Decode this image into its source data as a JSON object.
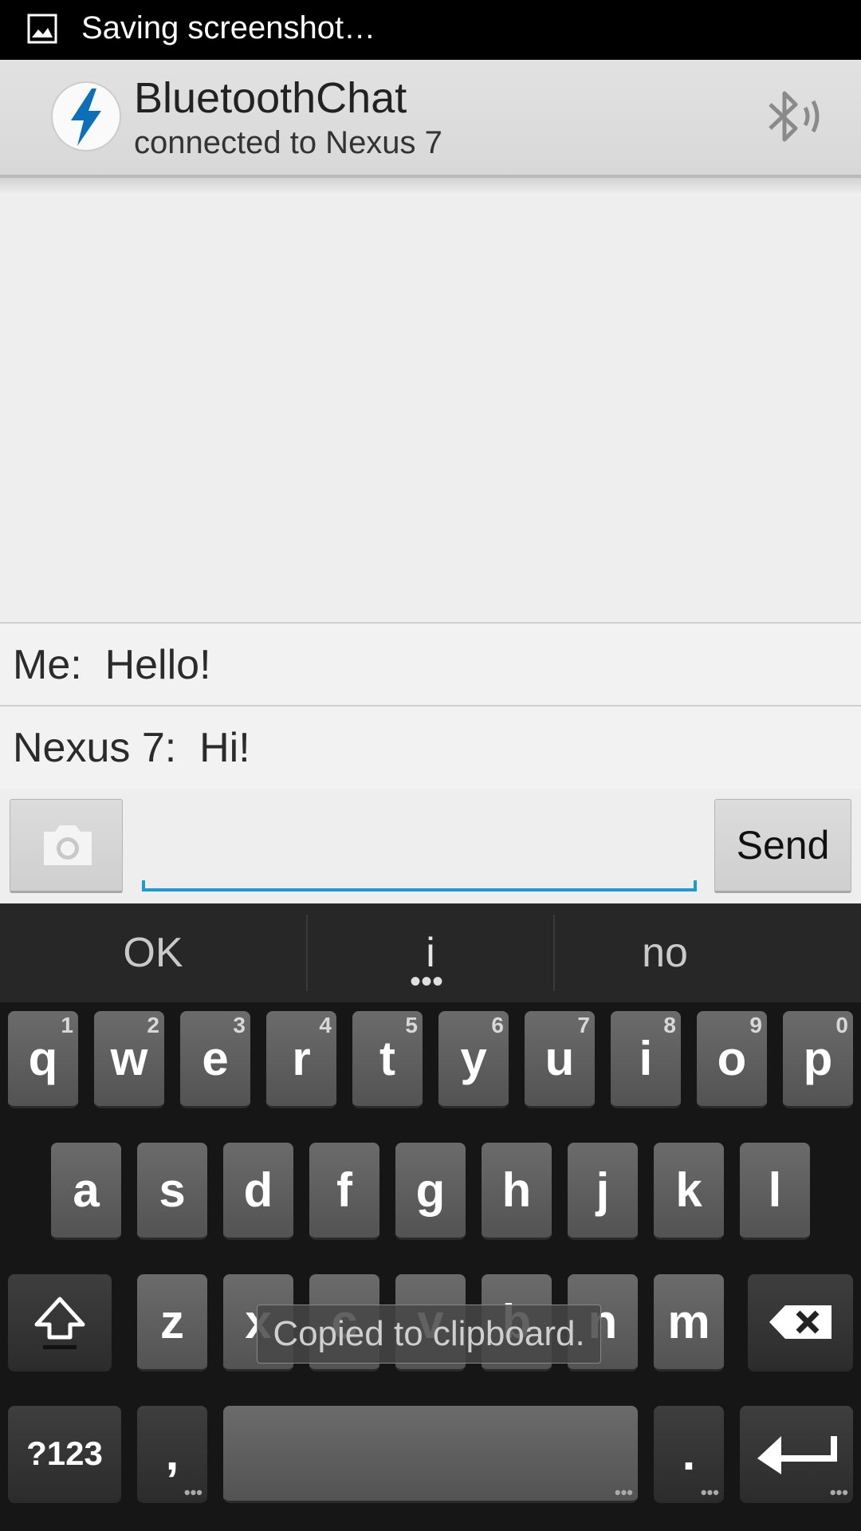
{
  "status_bar": {
    "text": "Saving screenshot…",
    "icon": "image-icon"
  },
  "action_bar": {
    "title": "BluetoothChat",
    "subtitle": "connected to Nexus 7",
    "app_icon": "lightning-bolt-icon",
    "action_icon": "bluetooth-discoverable-icon",
    "accent_color": "#0d6fb8"
  },
  "messages": [
    {
      "text": "Me:  Hello!"
    },
    {
      "text": "Nexus 7:  Hi!"
    }
  ],
  "compose": {
    "camera_icon": "camera-icon",
    "input_value": "",
    "send_label": "Send",
    "accent_color": "#1e9ad2"
  },
  "keyboard": {
    "suggestions": [
      "OK",
      "i",
      "no"
    ],
    "row1": [
      {
        "k": "q",
        "h": "1"
      },
      {
        "k": "w",
        "h": "2"
      },
      {
        "k": "e",
        "h": "3"
      },
      {
        "k": "r",
        "h": "4"
      },
      {
        "k": "t",
        "h": "5"
      },
      {
        "k": "y",
        "h": "6"
      },
      {
        "k": "u",
        "h": "7"
      },
      {
        "k": "i",
        "h": "8"
      },
      {
        "k": "o",
        "h": "9"
      },
      {
        "k": "p",
        "h": "0"
      }
    ],
    "row2": [
      "a",
      "s",
      "d",
      "f",
      "g",
      "h",
      "j",
      "k",
      "l"
    ],
    "row3": [
      "z",
      "x",
      "c",
      "v",
      "b",
      "n",
      "m"
    ],
    "symbols_label": "?123",
    "comma_label": ",",
    "period_label": ".",
    "shift_icon": "shift-icon",
    "backspace_icon": "backspace-icon",
    "enter_icon": "enter-icon"
  },
  "toast": {
    "text": "Copied to clipboard."
  }
}
